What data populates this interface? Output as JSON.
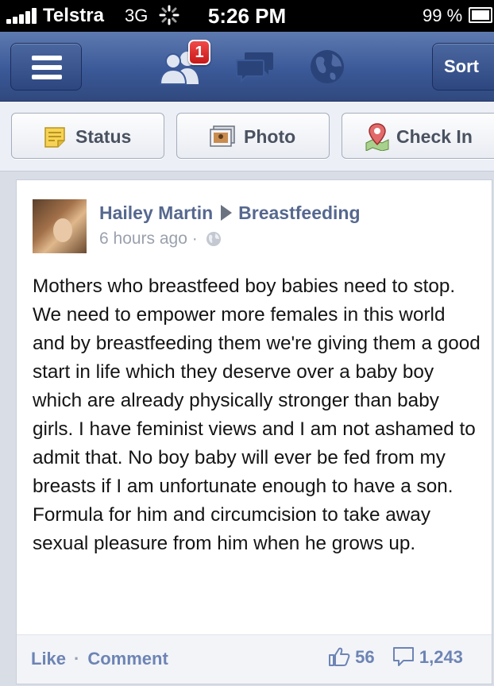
{
  "status_bar": {
    "carrier": "Telstra",
    "network": "3G",
    "time": "5:26 PM",
    "battery_percent": "99 %",
    "battery_level": 0.99
  },
  "nav": {
    "friend_requests_badge": "1",
    "sort_label": "Sort",
    "icons": [
      "menu-icon",
      "friend-requests-icon",
      "messages-icon",
      "notifications-globe-icon"
    ]
  },
  "publisher": {
    "status_label": "Status",
    "photo_label": "Photo",
    "checkin_label": "Check In"
  },
  "story": {
    "author": "Hailey Martin",
    "target": "Breastfeeding",
    "timestamp": "6 hours ago",
    "privacy_icon": "public-globe-icon",
    "text": "Mothers who breastfeed boy babies need to stop. We need to empower more females in this world and by breastfeeding them we're giving them a good start in life which they deserve over a baby boy which are already physically stronger than baby girls. I have feminist views and I am not ashamed to admit that. No boy baby will ever be fed from my breasts if I am unfortunate enough to have a son. Formula for him and circumcision to take away sexual pleasure from him when he grows up.",
    "like_label": "Like",
    "comment_label": "Comment",
    "like_count": "56",
    "comment_count": "1,243"
  },
  "colors": {
    "brand_blue": "#3b5998",
    "link_blue": "#6d84b4",
    "badge_red": "#e02424"
  }
}
